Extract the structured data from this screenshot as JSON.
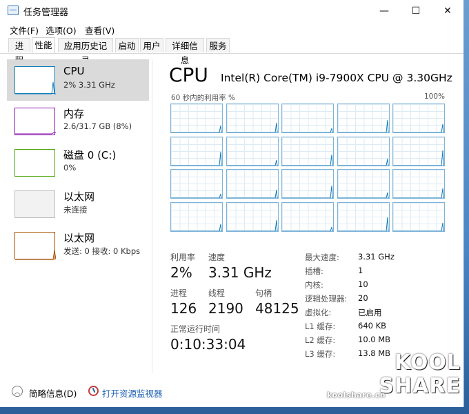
{
  "window": {
    "title": "任务管理器",
    "min": "—",
    "max": "☐",
    "close": "✕"
  },
  "menu": [
    "文件(F)",
    "选项(O)",
    "查看(V)"
  ],
  "tabs": [
    "进程",
    "性能",
    "应用历史记录",
    "启动",
    "用户",
    "详细信息",
    "服务"
  ],
  "active_tab": "性能",
  "sidebar": [
    {
      "title": "CPU",
      "sub": "2% 3.31 GHz",
      "color": "#117dbb"
    },
    {
      "title": "内存",
      "sub": "2.6/31.7 GB (8%)",
      "color": "#8b12ae"
    },
    {
      "title": "磁盘 0 (C:)",
      "sub": "0%",
      "color": "#4da60c"
    },
    {
      "title": "以太网",
      "sub": "未连接",
      "color": "#bdbdbd"
    },
    {
      "title": "以太网",
      "sub": "发送: 0 接收: 0 Kbps",
      "color": "#a74f01"
    }
  ],
  "main": {
    "heading": "CPU",
    "cpu_name": "Intel(R) Core(TM) i9-7900X CPU @ 3.30GHz",
    "graph_label": "60 秒内的利用率 %",
    "graph_max": "100%",
    "core_count_shown": 20,
    "stats": {
      "util_label": "利用率",
      "util_value": "2%",
      "speed_label": "速度",
      "speed_value": "3.31 GHz",
      "proc_label": "进程",
      "proc_value": "126",
      "thread_label": "线程",
      "thread_value": "2190",
      "handle_label": "句柄",
      "handle_value": "48125",
      "uptime_label": "正常运行时间",
      "uptime_value": "0:10:33:04"
    },
    "specs": [
      {
        "label": "最大速度:",
        "value": "3.31 GHz"
      },
      {
        "label": "插槽:",
        "value": "1"
      },
      {
        "label": "内核:",
        "value": "10"
      },
      {
        "label": "逻辑处理器:",
        "value": "20"
      },
      {
        "label": "虚拟化:",
        "value": "已启用"
      },
      {
        "label": "L1 缓存:",
        "value": "640 KB"
      },
      {
        "label": "L2 缓存:",
        "value": "10.0 MB"
      },
      {
        "label": "L3 缓存:",
        "value": "13.8 MB"
      }
    ]
  },
  "footer": {
    "collapse_label": "简略信息(D)",
    "monitor_label": "打开资源监视器"
  },
  "watermark": {
    "line1": "KOOL",
    "line2": "SHARE",
    "url": "koolshare.cn"
  },
  "colors": {
    "accent": "#117dbb",
    "link": "#1a5fb4"
  }
}
